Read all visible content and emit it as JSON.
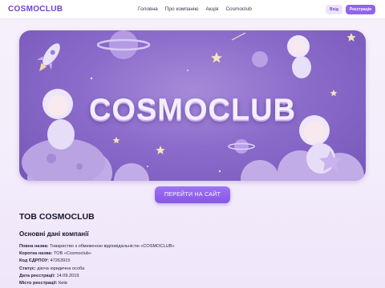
{
  "header": {
    "logo": "COSMOCLUB",
    "nav": [
      "Головна",
      "Про компанію",
      "Акція",
      "Cosmoclub"
    ],
    "login_label": "Вхід",
    "register_label": "Реєстрація"
  },
  "hero": {
    "title": "COSMOCLUB"
  },
  "cta_label": "ПЕРЕЙТИ НА САЙТ",
  "company": {
    "name": "ТОВ COSMOCLUB",
    "section_title": "Основні дані компанії",
    "details": [
      {
        "key": "Повна назва:",
        "value": "Товариство з обмеженою відповідальністю «COSMOCLUB»"
      },
      {
        "key": "Коротка назва:",
        "value": "ТОВ «Cosmoclub»"
      },
      {
        "key": "Код ЄДРПОУ:",
        "value": "47263915"
      },
      {
        "key": "Статус:",
        "value": "діюча юридична особа"
      },
      {
        "key": "Дата реєстрації:",
        "value": "14.09.2019"
      },
      {
        "key": "Місто реєстрації:",
        "value": "Київ"
      }
    ]
  },
  "colors": {
    "accent": "#9164ee",
    "logo": "#6f3fd0",
    "hero_bg": "#8c6ccb"
  }
}
